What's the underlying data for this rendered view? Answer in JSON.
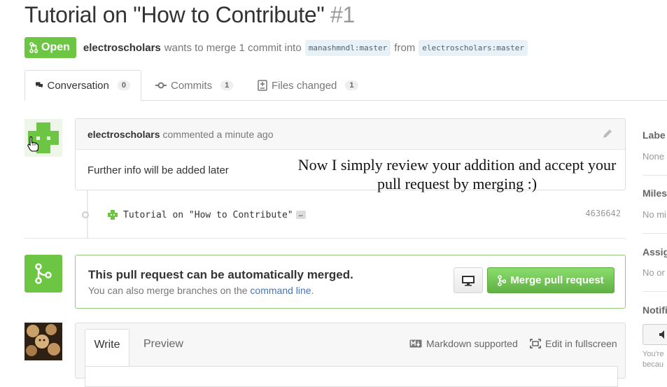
{
  "header": {
    "title": "Tutorial on \"How to Contribute\"",
    "number": "#1",
    "state": "Open",
    "author": "electroscholars",
    "merge_text": "wants to merge 1 commit into",
    "base_branch": "manashmndl:master",
    "from_text": "from",
    "head_branch": "electroscholars:master"
  },
  "tabs": [
    {
      "label": "Conversation",
      "count": "0",
      "icon": "comment-discussion-icon",
      "selected": true
    },
    {
      "label": "Commits",
      "count": "1",
      "icon": "git-commit-icon",
      "selected": false
    },
    {
      "label": "Files changed",
      "count": "1",
      "icon": "diff-icon",
      "selected": false
    }
  ],
  "comment": {
    "author": "electroscholars",
    "action": "commented a minute ago",
    "body": "Further info will be added later"
  },
  "commit": {
    "message": "Tutorial on \"How to Contribute\"",
    "ellipsis": "…",
    "sha": "4636642"
  },
  "merge": {
    "title": "This pull request can be automatically merged.",
    "subtitle_prefix": "You can also merge branches on the",
    "subtitle_link": "command line",
    "subtitle_suffix": ".",
    "button_label": "Merge pull request"
  },
  "composer": {
    "write_tab": "Write",
    "preview_tab": "Preview",
    "markdown_label": "Markdown supported",
    "fullscreen_label": "Edit in fullscreen"
  },
  "sidebar": {
    "labels_heading": "Labe",
    "labels_value": "None",
    "milestone_heading": "Miles",
    "milestone_value": "No mi",
    "assignee_heading": "Assig",
    "assignee_value": "No or",
    "notifications_heading": "Notifi",
    "notifications_text_1": "You're",
    "notifications_text_2": "becau"
  },
  "overlay": {
    "line1": "Now I simply review your addition and accept your",
    "line2": "pull request by merging :)"
  },
  "colors": {
    "open_green": "#6cc644",
    "link_blue": "#4078c0",
    "branch_bg": "#e8f1f6"
  }
}
